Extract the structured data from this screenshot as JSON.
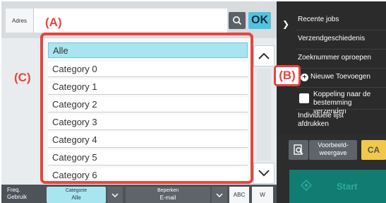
{
  "address": {
    "label": "Adres",
    "value": "",
    "ok_label": "OK"
  },
  "list": {
    "items": [
      {
        "label": "Alle",
        "selected": true
      },
      {
        "label": "Category 0",
        "selected": false
      },
      {
        "label": "Category 1",
        "selected": false
      },
      {
        "label": "Category 2",
        "selected": false
      },
      {
        "label": "Category 3",
        "selected": false
      },
      {
        "label": "Category 4",
        "selected": false
      },
      {
        "label": "Category 5",
        "selected": false
      },
      {
        "label": "Category 6",
        "selected": false
      }
    ]
  },
  "callouts": {
    "a": "(A)",
    "b": "(B)",
    "c": "(C)"
  },
  "bottom": {
    "freq_line1": "Freq.",
    "freq_line2": "Gebruik",
    "category_label": "Categorie",
    "category_value": "Alle",
    "restrict_label": "Beperken",
    "restrict_value": "E-mail",
    "abc_label": "ABC",
    "w_label": "W"
  },
  "right_menu": {
    "recent_jobs": "Recente jobs",
    "send_history": "Verzendgeschiedenis",
    "search_number": "Zoeknummer oproepen",
    "add_new": "Nieuwe Toevoegen",
    "link_line1": "Koppeling naar de",
    "link_line2": "bestemming verzenden",
    "print_line1": "Individuele lijst",
    "print_line2": "afdrukken"
  },
  "actions": {
    "preview_line1": "Voorbeeld-",
    "preview_line2": "weergave",
    "ca_label": "CA",
    "start_label": "Start"
  },
  "colors": {
    "accent": "#e8453c",
    "selected_bg": "#a9e5ef",
    "ok_bg": "#4fc3e0",
    "start_bg": "#117d72",
    "ca_bg": "#f1c84a"
  }
}
